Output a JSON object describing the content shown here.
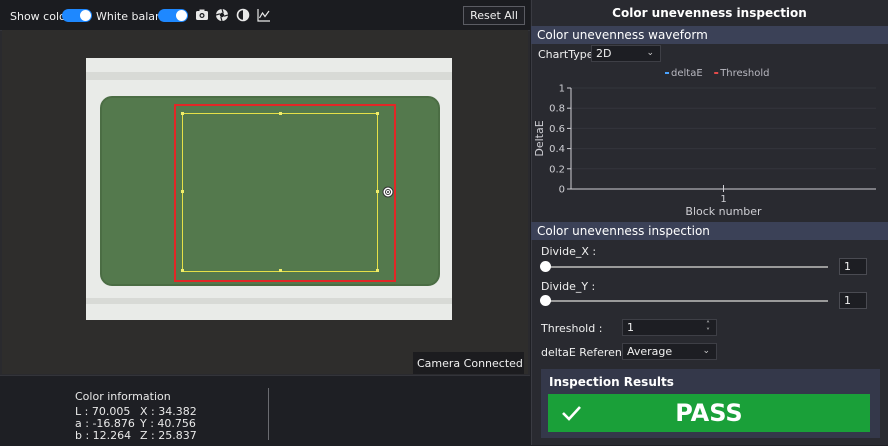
{
  "toolbar": {
    "show_color_label": "Show color",
    "show_color_on": true,
    "white_balance_label": "White balance",
    "white_balance_on": true,
    "icons": [
      "camera-icon",
      "aperture-icon",
      "contrast-icon",
      "chart-line-icon"
    ],
    "reset_label": "Reset All"
  },
  "viewer": {
    "camera_status": "Camera Connected",
    "camera_status_icon": "camera-connection-icon"
  },
  "color_info": {
    "title": "Color information",
    "L": "L : 70.005",
    "a": "a : -16.876",
    "b": "b : 12.264",
    "X": "X : 34.382",
    "Y": "Y : 40.756",
    "Z": "Z : 25.837"
  },
  "right_panel": {
    "title": "Color unevenness inspection",
    "waveform_header": "Color unevenness waveform",
    "chart_type_label": "ChartType :",
    "chart_type_value": "2D",
    "inspection_header": "Color unevenness inspection",
    "divide_x_label": "Divide_X :",
    "divide_x_value": "1",
    "divide_x_fraction": 0.0,
    "divide_y_label": "Divide_Y :",
    "divide_y_value": "1",
    "divide_y_fraction": 0.0,
    "threshold_label": "Threshold :",
    "threshold_value": "1",
    "reference_label": "deltaE Reference :",
    "reference_value": "Average",
    "results_title": "Inspection Results",
    "result": "PASS",
    "colors": {
      "accent": "#1e88ff",
      "pass": "#1aa039",
      "roi_red": "#e22727",
      "roi_yellow": "#e5e048",
      "legend_deltaE": "#4aa3ff",
      "legend_threshold": "#e24a4a"
    }
  },
  "chart_data": {
    "type": "line",
    "title": "",
    "xlabel": "Block number",
    "ylabel": "DeltaE",
    "x_ticks": [
      "1"
    ],
    "y_ticks": [
      "0",
      "0.2",
      "0.4",
      "0.6",
      "0.8",
      "1"
    ],
    "ylim": [
      0,
      1
    ],
    "legend": [
      "deltaE",
      "Threshold"
    ],
    "legend_placement": "top",
    "grid": true,
    "series": [
      {
        "name": "deltaE",
        "values": []
      },
      {
        "name": "Threshold",
        "values": []
      }
    ]
  }
}
